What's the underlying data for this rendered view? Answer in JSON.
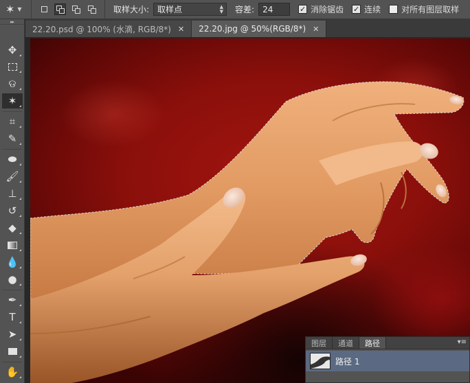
{
  "options_bar": {
    "tool_icon": "magic-wand-icon",
    "sample_size_label": "取样大小:",
    "sample_size_value": "取样点",
    "tolerance_label": "容差:",
    "tolerance_value": "24",
    "anti_alias_label": "消除锯齿",
    "anti_alias_checked": true,
    "contiguous_label": "连续",
    "contiguous_checked": true,
    "sample_all_layers_label": "对所有图层取样",
    "sample_all_layers_checked": false
  },
  "tabs": [
    {
      "label": "22.20.psd @ 100% (水滴, RGB/8*)",
      "active": false
    },
    {
      "label": "22.20.jpg @ 50%(RGB/8*)",
      "active": true
    }
  ],
  "tools": [
    "move-icon",
    "marquee-icon",
    "lasso-icon",
    "magic-wand-icon",
    "crop-icon",
    "eyedropper-icon",
    "healing-brush-icon",
    "brush-icon",
    "clone-stamp-icon",
    "history-brush-icon",
    "eraser-icon",
    "gradient-icon",
    "blur-icon",
    "dodge-icon",
    "pen-icon",
    "type-icon",
    "path-selection-icon",
    "rectangle-icon",
    "hand-icon"
  ],
  "panel": {
    "tabs": [
      "图层",
      "通道",
      "路径"
    ],
    "active_tab": "路径",
    "path_item": "路径 1"
  },
  "colors": {
    "ui_dark": "#535353",
    "selected_row": "#5b6a82",
    "canvas_red": "#a3150f",
    "skin": "#e9a06a"
  }
}
